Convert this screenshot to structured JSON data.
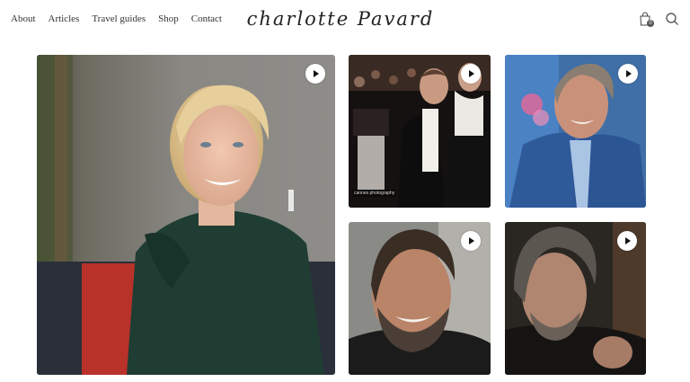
{
  "nav": {
    "items": [
      "About",
      "Articles",
      "Travel guides",
      "Shop",
      "Contact"
    ]
  },
  "logo": {
    "text": "charlotte Pavard"
  },
  "header_icons": {
    "bag": "shopping-bag-icon",
    "bag_count": "0",
    "search": "search-icon"
  },
  "gallery": {
    "tiles": [
      {
        "subject": "woman-portrait",
        "play_icon": "play-icon"
      },
      {
        "subject": "man-tuxedo-event",
        "play_icon": "play-icon",
        "caption": "cannes photography"
      },
      {
        "subject": "man-blue-suit",
        "play_icon": "play-icon"
      },
      {
        "subject": "man-bearded-smile",
        "play_icon": "play-icon"
      },
      {
        "subject": "man-gray-hair",
        "play_icon": "play-icon"
      }
    ]
  },
  "colors": {
    "text": "#333333",
    "background": "#ffffff",
    "play_button": "#ffffff"
  }
}
